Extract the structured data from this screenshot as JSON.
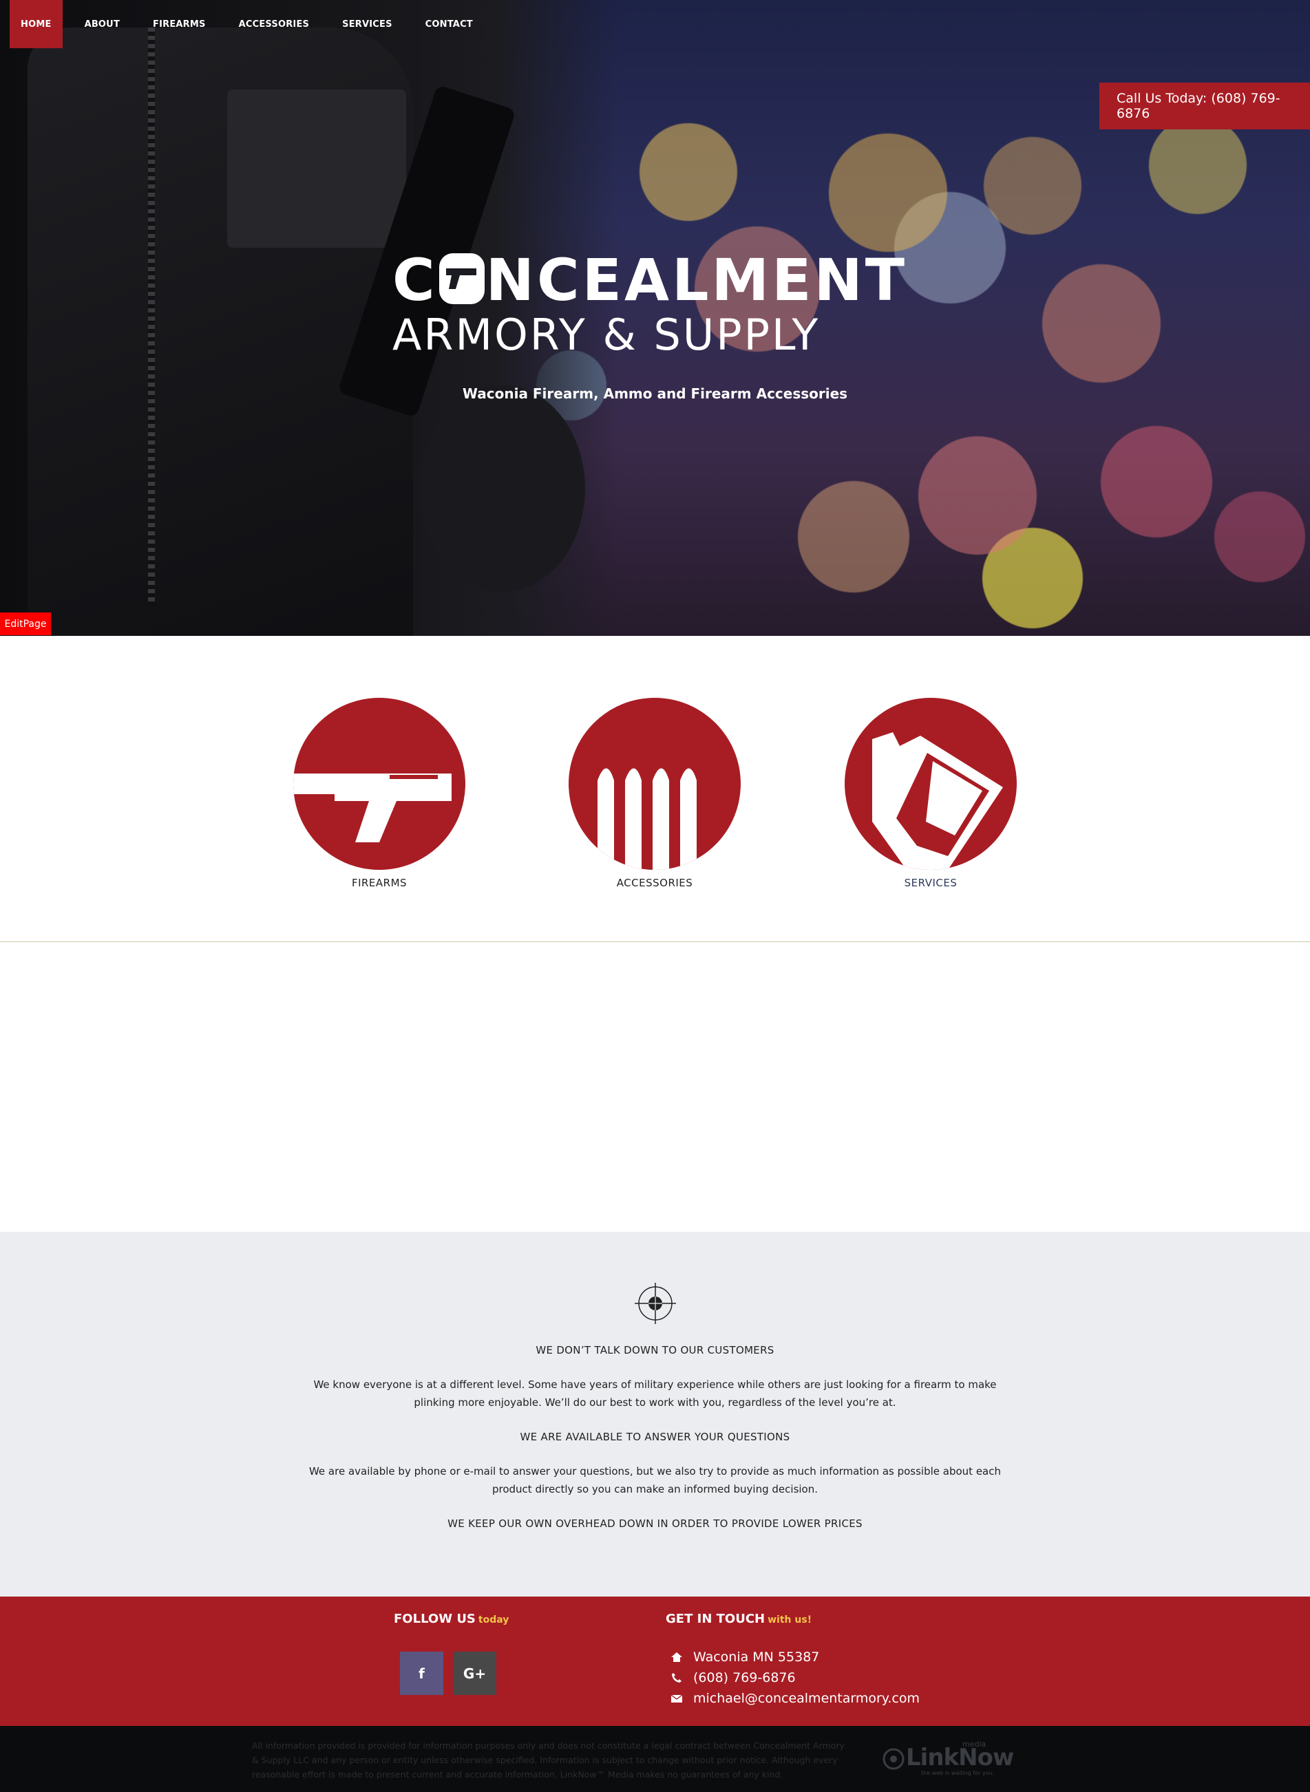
{
  "nav": {
    "items": [
      "HOME",
      "ABOUT",
      "FIREARMS",
      "ACCESSORIES",
      "SERVICES",
      "CONTACT"
    ],
    "active": "HOME"
  },
  "hero": {
    "call_text": "Call Us Today: (608) 769-6876",
    "logo_line1_a": "C",
    "logo_line1_b": "NCEALMENT",
    "logo_line2": "ARMORY & SUPPLY",
    "tagline": "Waconia Firearm, Ammo and Firearm Accessories",
    "edit_label": "EditPage"
  },
  "categories": [
    {
      "label": "FIREARMS",
      "icon": "pistol-icon"
    },
    {
      "label": "ACCESSORIES",
      "icon": "bullets-icon"
    },
    {
      "label": "SERVICES",
      "icon": "tools-icon"
    }
  ],
  "info": {
    "heading1": "WE DON’T TALK DOWN TO OUR CUSTOMERS",
    "para1_line1": "We know everyone is at a different level. Some have years of military experience while others are just looking for a firearm to make",
    "para1_line2": "plinking more enjoyable. We’ll do our best to work with you, regardless of the level you’re at.",
    "heading2": "WE ARE AVAILABLE TO ANSWER YOUR QUESTIONS",
    "para2_line1": "We are available by phone or e-mail to answer your questions, but we also try to provide as much information as possible about each",
    "para2_line2": "product directly so you can make an informed buying decision.",
    "heading3": "WE KEEP OUR OWN OVERHEAD DOWN IN ORDER TO PROVIDE LOWER PRICES"
  },
  "footer": {
    "follow_title": "FOLLOW US",
    "follow_accent": "today",
    "touch_title": "GET IN TOUCH",
    "touch_accent": "with us!",
    "facebook": "f",
    "googleplus": "G+",
    "address": "Waconia MN 55387",
    "phone": "(608) 769-6876",
    "email": "michael@concealmentarmory.com",
    "disclaimer": "All information provided is provided for information purposes only and does not constitute a legal contract between Concealment Armory & Supply LLC and any person or entity unless otherwise specified. Information is subject to change without prior notice. Although every reasonable effort is made to present current and accurate information, LinkNow™ Media makes no guarantees of any kind.",
    "brand": "LinkNow",
    "brand_media": "media",
    "brand_tag": "the web is waiting for you."
  },
  "colors": {
    "accent": "#a81d24",
    "info_bg": "#ebedf0",
    "footer_dark": "#0b0c0e",
    "facebook": "#5b5581",
    "googleplus": "#484848"
  }
}
